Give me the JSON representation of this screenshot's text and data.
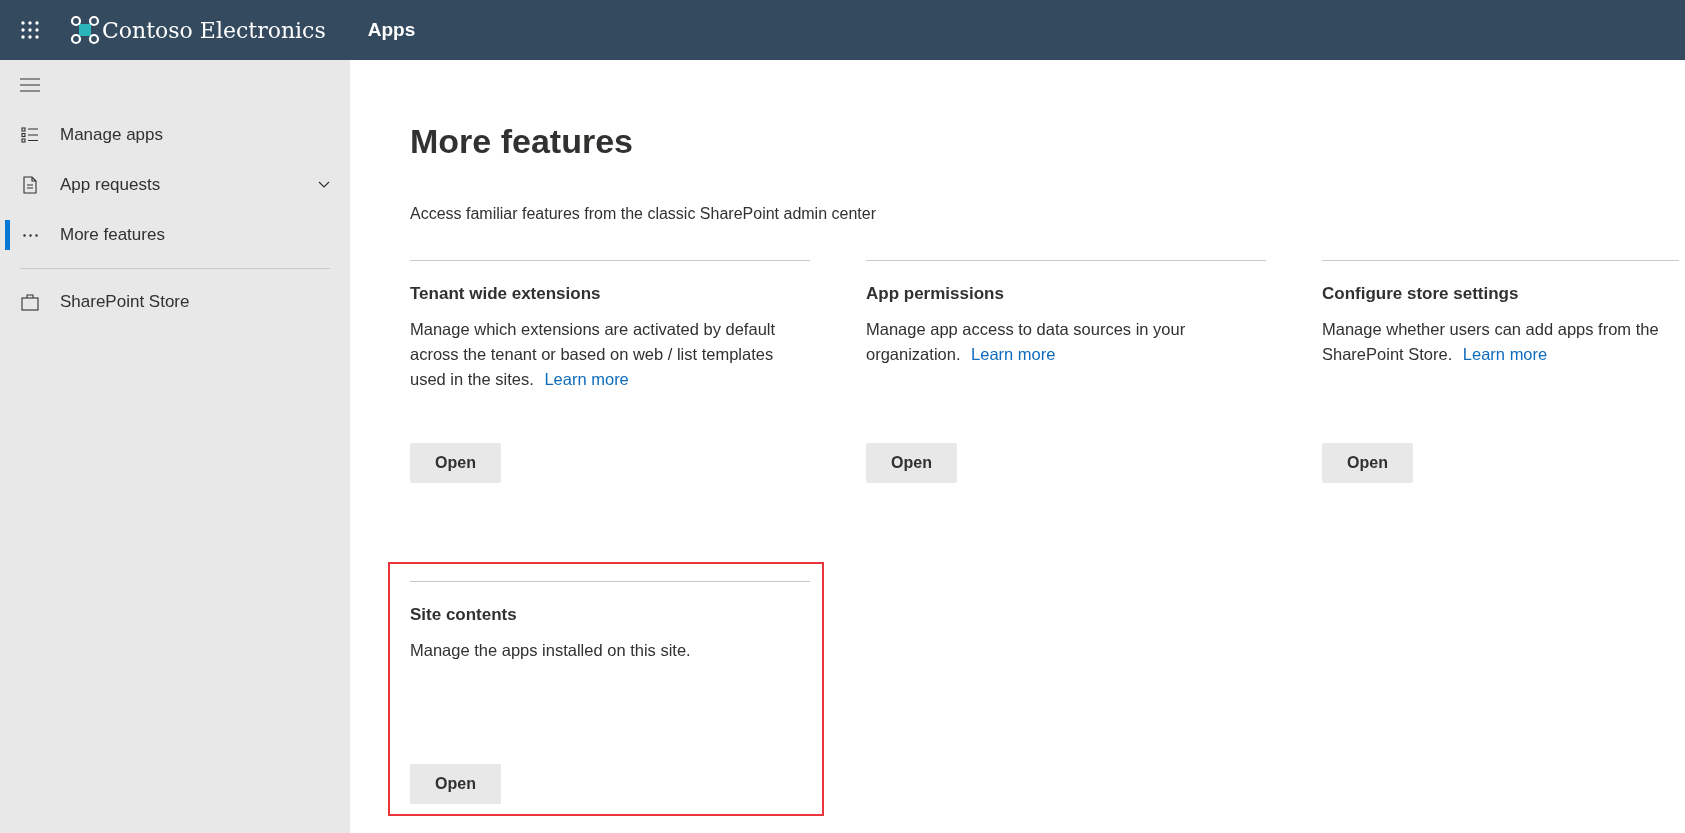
{
  "header": {
    "brand": "Contoso Electronics",
    "app": "Apps"
  },
  "sidebar": {
    "items": [
      {
        "kind": "list",
        "label": "Manage apps",
        "selected": false,
        "expandable": false
      },
      {
        "kind": "document",
        "label": "App requests",
        "selected": false,
        "expandable": true
      },
      {
        "kind": "more",
        "label": "More features",
        "selected": true,
        "expandable": false
      },
      {
        "kind": "divider"
      },
      {
        "kind": "bag",
        "label": "SharePoint Store",
        "selected": false,
        "expandable": false
      }
    ]
  },
  "page": {
    "title": "More features",
    "subtitle": "Access familiar features from the classic SharePoint admin center"
  },
  "cards": [
    {
      "title": "Tenant wide extensions",
      "description": "Manage which extensions are activated by default across the tenant or based on web / list templates used in the sites.",
      "link": "Learn more",
      "button": "Open",
      "highlighted": false
    },
    {
      "title": "App permissions",
      "description": "Manage app access to data sources in your organization.",
      "link": "Learn more",
      "button": "Open",
      "highlighted": false
    },
    {
      "title": "Configure store settings",
      "description": "Manage whether users can add apps from the SharePoint Store.",
      "link": "Learn more",
      "button": "Open",
      "highlighted": false
    },
    {
      "title": "Site contents",
      "description": "Manage the apps installed on this site.",
      "button": "Open",
      "highlighted": true
    }
  ]
}
